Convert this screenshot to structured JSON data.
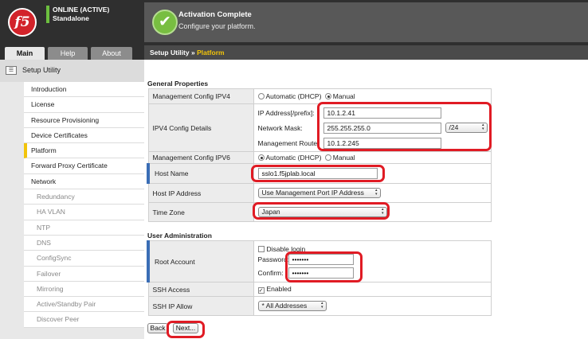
{
  "header": {
    "logo_text": "f5",
    "status_line1": "ONLINE (ACTIVE)",
    "status_line2": "Standalone",
    "activation_title": "Activation Complete",
    "activation_sub": "Configure your platform.",
    "check_glyph": "✔"
  },
  "tabs": [
    {
      "label": "Main"
    },
    {
      "label": "Help"
    },
    {
      "label": "About"
    }
  ],
  "breadcrumb": {
    "root": "Setup Utility",
    "sep": "»",
    "current": "Platform"
  },
  "nav": {
    "header": "Setup Utility",
    "items": [
      {
        "label": "Introduction"
      },
      {
        "label": "License"
      },
      {
        "label": "Resource Provisioning"
      },
      {
        "label": "Device Certificates"
      },
      {
        "label": "Platform"
      },
      {
        "label": "Forward Proxy Certificate"
      },
      {
        "label": "Network"
      },
      {
        "label": "Redundancy"
      },
      {
        "label": "HA VLAN"
      },
      {
        "label": "NTP"
      },
      {
        "label": "DNS"
      },
      {
        "label": "ConfigSync"
      },
      {
        "label": "Failover"
      },
      {
        "label": "Mirroring"
      },
      {
        "label": "Active/Standby Pair"
      },
      {
        "label": "Discover Peer"
      }
    ]
  },
  "general": {
    "title": "General Properties",
    "mgmt_ipv4_label": "Management Config IPV4",
    "mgmt_ipv4_opt_auto": "Automatic (DHCP)",
    "mgmt_ipv4_opt_manual": "Manual",
    "ipv4_details_label": "IPV4 Config Details",
    "ip_address_label": "IP Address[/prefix]:",
    "ip_address_value": "10.1.2.41",
    "netmask_label": "Network Mask:",
    "netmask_value": "255.255.255.0",
    "prefix_value": "/24",
    "mgmt_route_label": "Management Route",
    "mgmt_route_value": "10.1.2.245",
    "mgmt_ipv6_label": "Management Config IPV6",
    "mgmt_ipv6_opt_auto": "Automatic (DHCP)",
    "mgmt_ipv6_opt_manual": "Manual",
    "hostname_label": "Host Name",
    "hostname_value": "sslo1.f5jplab.local",
    "host_ip_label": "Host IP Address",
    "host_ip_value": "Use Management Port IP Address",
    "timezone_label": "Time Zone",
    "timezone_value": "Japan"
  },
  "user_admin": {
    "title": "User Administration",
    "root_label": "Root Account",
    "disable_login_label": "Disable login",
    "password_label": "Password:",
    "password_value": "•••••••",
    "confirm_label": "Confirm:",
    "confirm_value": "•••••••",
    "ssh_access_label": "SSH Access",
    "ssh_enabled_label": "Enabled",
    "ssh_ip_label": "SSH IP Allow",
    "ssh_ip_value": "* All Addresses"
  },
  "buttons": {
    "back": "Back",
    "next": "Next..."
  },
  "colors": {
    "highlight": "#e01b24",
    "active_nav": "#f2c40a",
    "required_bar": "#3a6db5"
  }
}
